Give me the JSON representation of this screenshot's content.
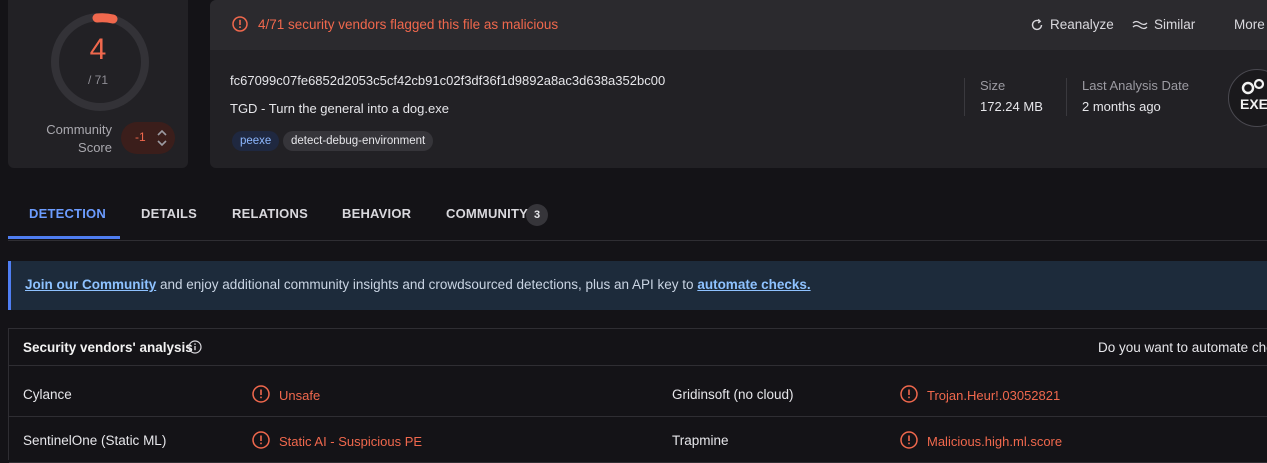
{
  "score": {
    "detections": "4",
    "total": "/ 71",
    "community_label_1": "Community",
    "community_label_2": "Score",
    "community_value": "-1"
  },
  "header": {
    "flag_message": "4/71 security vendors flagged this file as malicious",
    "buttons": {
      "reanalyze": "Reanalyze",
      "similar": "Similar",
      "more": "More"
    }
  },
  "file": {
    "hash": "fc67099c07fe6852d2053c5cf42cb91c02f3df36f1d9892a8ac3d638a352bc00",
    "name": "TGD - Turn the general into a dog.exe",
    "tags": [
      "peexe",
      "detect-debug-environment"
    ],
    "size_label": "Size",
    "size_value": "172.24 MB",
    "analysis_label": "Last Analysis Date",
    "analysis_value": "2 months ago",
    "type_badge": "EXE"
  },
  "tabs": [
    {
      "label": "DETECTION",
      "active": true
    },
    {
      "label": "DETAILS"
    },
    {
      "label": "RELATIONS"
    },
    {
      "label": "BEHAVIOR"
    },
    {
      "label": "COMMUNITY",
      "count": "3"
    }
  ],
  "banner": {
    "link1": "Join our Community",
    "middle": " and enjoy additional community insights and crowdsourced detections, plus an API key to ",
    "link2": "automate checks."
  },
  "vendors": {
    "title": "Security vendors' analysis",
    "right_prompt": "Do you want to automate checks?",
    "rows": [
      [
        {
          "vendor": "Cylance",
          "result": "Unsafe"
        },
        {
          "vendor": "Gridinsoft (no cloud)",
          "result": "Trojan.Heur!.03052821"
        }
      ],
      [
        {
          "vendor": "SentinelOne (Static ML)",
          "result": "Static AI - Suspicious PE"
        },
        {
          "vendor": "Trapmine",
          "result": "Malicious.high.ml.score"
        }
      ]
    ]
  },
  "colors": {
    "malicious": "#f0684d",
    "accent": "#4f7ef2",
    "link": "#8ec2ff"
  }
}
